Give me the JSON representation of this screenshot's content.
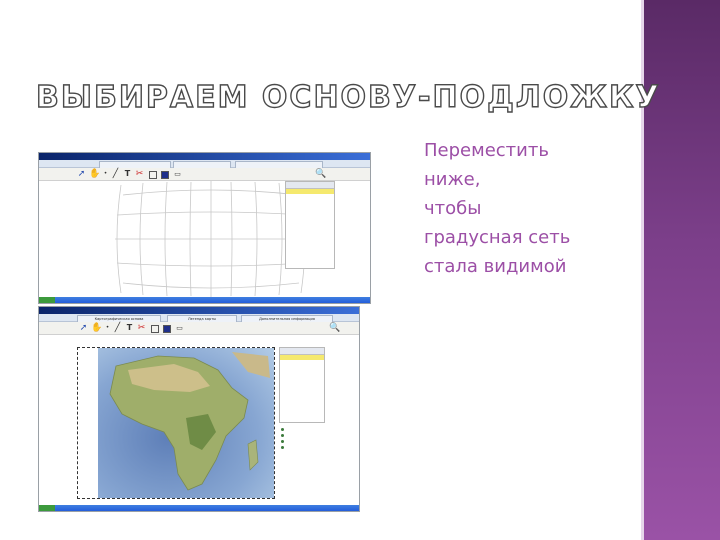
{
  "slide": {
    "title": "ВЫБИРАЕМ ОСНОВУ-ПОДЛОЖКУ",
    "caption_lines": [
      "Переместить",
      "ниже,",
      "чтобы",
      "градусная сеть",
      "стала видимой"
    ],
    "accent_color": "#9c4fa6",
    "band_color": "#7c3f8a"
  },
  "screenshot_top": {
    "window_title": "",
    "tabs": [
      "",
      "",
      ""
    ],
    "layers_panel": {
      "selected_layer": "",
      "note": ""
    }
  },
  "screenshot_bottom": {
    "window_title": "",
    "tabs": [
      "Картографическая основа",
      "Легенда карты",
      "Дополнительная информация"
    ],
    "layers_panel": {
      "items": [
        "",
        ""
      ]
    },
    "properties": [
      "",
      "",
      "",
      ""
    ]
  },
  "icons": [
    "arrow-icon",
    "hand-icon",
    "point-icon",
    "line-icon",
    "text-icon",
    "scissors-icon",
    "square-outline-icon",
    "square-filled-icon",
    "shapes-icon",
    "zoom-icon"
  ]
}
